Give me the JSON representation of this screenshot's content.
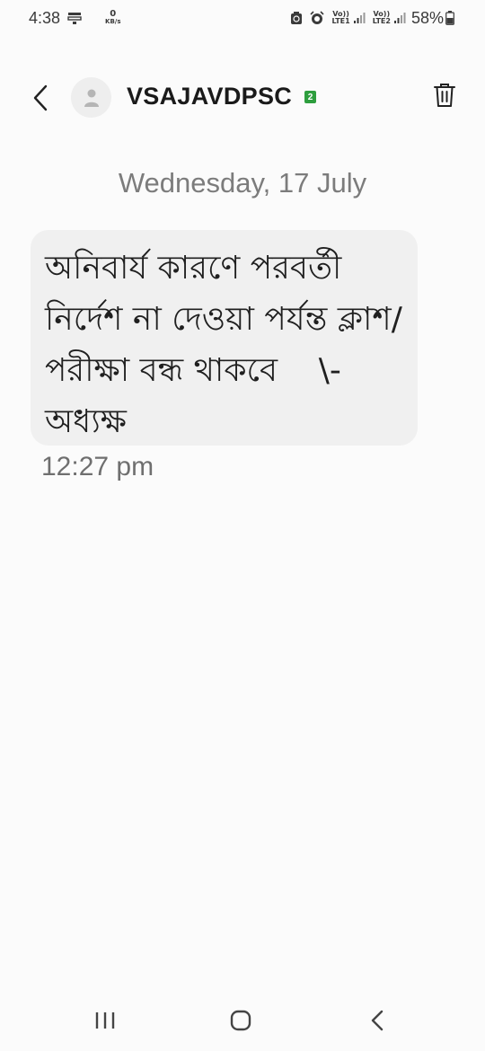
{
  "status_bar": {
    "time": "4:38",
    "net_speed_value": "0",
    "net_speed_unit": "KB/s",
    "sim1_label": "Vo))\nLTE1",
    "sim1_top": "Vo))",
    "sim1_bottom": "LTE1",
    "sim2_top": "Vo))",
    "sim2_bottom": "LTE2",
    "battery_percent": "58%",
    "icons": [
      "screen-mirror-icon",
      "recycle-icon",
      "alarm-icon",
      "signal-icon",
      "battery-icon"
    ]
  },
  "header": {
    "sender": "VSAJAVDPSC",
    "sim_badge": "2",
    "icons": [
      "back-arrow-icon",
      "person-icon",
      "trash-icon"
    ]
  },
  "conversation": {
    "date": "Wednesday, 17 July",
    "messages": [
      {
        "text": "অনিবার্য কারণে পরবর্তী নির্দেশ না দেওয়া পর্যন্ত ক্লাশ/পরীক্ষা বন্ধ থাকবে    \\- অধ্যক্ষ",
        "time": "12:27 pm"
      }
    ]
  },
  "nav_bar": {
    "icons": [
      "recents-icon",
      "home-icon",
      "back-icon"
    ]
  },
  "colors": {
    "background": "#fbfbfb",
    "bubble": "#f0f0f0",
    "sim_badge": "#2e9e3e"
  }
}
